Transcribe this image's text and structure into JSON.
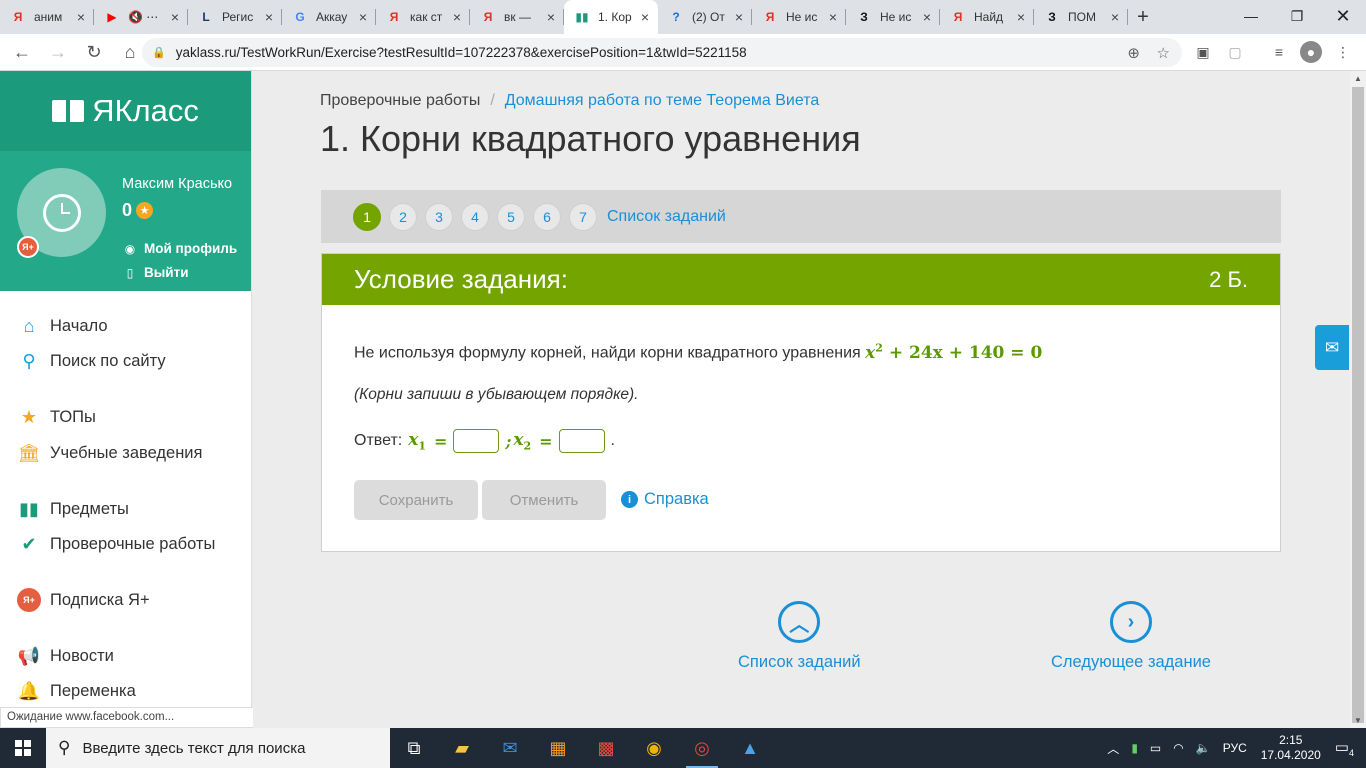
{
  "browser": {
    "tabs": [
      {
        "favicon": "Я",
        "fav_color": "#e0322b",
        "title": "аним"
      },
      {
        "favicon": "▶",
        "fav_color": "#ff0000",
        "title": "🔇 ⋯"
      },
      {
        "favicon": "L",
        "fav_color": "#1b3b6f",
        "title": "Регис"
      },
      {
        "favicon": "G",
        "fav_color": "#4285f4",
        "title": "Аккау"
      },
      {
        "favicon": "Я",
        "fav_color": "#e0322b",
        "title": "как ст"
      },
      {
        "favicon": "Я",
        "fav_color": "#e0322b",
        "title": "вк —"
      },
      {
        "favicon": "▮▮",
        "fav_color": "#1b9b7c",
        "title": "1. Кор",
        "active": true
      },
      {
        "favicon": "?",
        "fav_color": "#1a6fd6",
        "title": "(2) От"
      },
      {
        "favicon": "Я",
        "fav_color": "#e0322b",
        "title": "Не ис"
      },
      {
        "favicon": "З",
        "fav_color": "#111111",
        "title": "Не ис"
      },
      {
        "favicon": "Я",
        "fav_color": "#e0322b",
        "title": "Найд"
      },
      {
        "favicon": "З",
        "fav_color": "#111111",
        "title": "ПОМ"
      }
    ],
    "url": "yaklass.ru/TestWorkRun/Exercise?testResultId=107222378&exercisePosition=1&twId=5221158",
    "status": "Ожидание www.facebook.com..."
  },
  "sidebar": {
    "logo": "ЯКласс",
    "user_name": "Максим Красько",
    "score": "0",
    "profile_label": "Мой профиль",
    "logout_label": "Выйти",
    "items": [
      {
        "label": "Начало",
        "icon": "home-icon"
      },
      {
        "label": "Поиск по сайту",
        "icon": "search-icon"
      },
      {
        "label": "ТОПы",
        "icon": "star-icon"
      },
      {
        "label": "Учебные заведения",
        "icon": "institution-icon"
      },
      {
        "label": "Предметы",
        "icon": "book-icon"
      },
      {
        "label": "Проверочные работы",
        "icon": "check-circle-icon"
      },
      {
        "label": "Подписка Я+",
        "icon": "ya-plus-icon"
      },
      {
        "label": "Новости",
        "icon": "megaphone-icon"
      },
      {
        "label": "Переменка",
        "icon": "bell-icon"
      }
    ]
  },
  "main": {
    "breadcrumb_root": "Проверочные работы",
    "breadcrumb_link": "Домашняя работа по теме Теорема Виета",
    "title": "1. Корни квадратного уравнения",
    "steps": [
      "1",
      "2",
      "3",
      "4",
      "5",
      "6",
      "7"
    ],
    "active_step": "1",
    "task_list_label": "Список заданий",
    "task_header": "Условие задания:",
    "points": "2 Б.",
    "task_text": "Не используя формулу корней, найди корни квадратного уравнения",
    "equation": {
      "x": "x",
      "exp": "2",
      "rest": "+ 24x + 140 = 0"
    },
    "task_note": "(Корни запиши в убывающем порядке).",
    "answer_label": "Ответ:",
    "x1_label": "x",
    "x1_sub": "1",
    "x2_label": "x",
    "x2_sub": "2",
    "equals": "=",
    "semicolon": ";",
    "period": ".",
    "x1_value": "",
    "x2_value": "",
    "save_label": "Сохранить",
    "cancel_label": "Отменить",
    "help_label": "Справка",
    "nav_list_label": "Список заданий",
    "nav_next_label": "Следующее задание"
  },
  "taskbar": {
    "search_placeholder": "Введите здесь текст для поиска",
    "lang": "РУС",
    "time": "2:15",
    "date": "17.04.2020",
    "notifications": "4"
  }
}
